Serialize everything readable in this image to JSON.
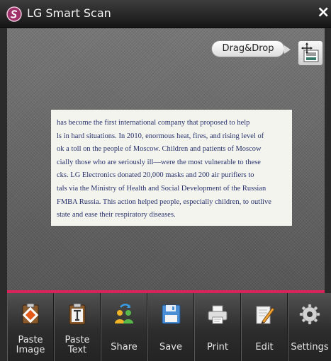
{
  "window": {
    "title": "LG Smart Scan",
    "close_label": "×"
  },
  "scan_area": {
    "dragdrop_label": "Drag&Drop",
    "document_lines": [
      "has become the first international company that proposed to help",
      "ls in hard situations. In 2010, enormous heat, fires, and rising level of",
      "ok a toll on the people of Moscow. Children and patients of Moscow",
      "cially those who are seriously ill—were the most vulnerable to these",
      "cks. LG Electronics donated 20,000 masks and 200 air purifiers to",
      "tals via the Ministry of Health and Social Development of the Russian",
      "FMBA Russia. This action helped people, especially children, to outlive",
      "state and ease their respiratory diseases."
    ]
  },
  "toolbar": {
    "items": [
      {
        "label": "Paste\nImage",
        "icon": "paste-image-icon"
      },
      {
        "label": "Paste\nText",
        "icon": "paste-text-icon"
      },
      {
        "label": "Share",
        "icon": "share-icon"
      },
      {
        "label": "Save",
        "icon": "floppy-disk-icon"
      },
      {
        "label": "Print",
        "icon": "printer-icon"
      },
      {
        "label": "Edit",
        "icon": "pencil-icon"
      },
      {
        "label": "Settings",
        "icon": "gear-icon"
      }
    ]
  },
  "colors": {
    "accent": "#d8245a",
    "titlebar": "#1e1e1e",
    "toolbar": "#3a3a3a"
  }
}
